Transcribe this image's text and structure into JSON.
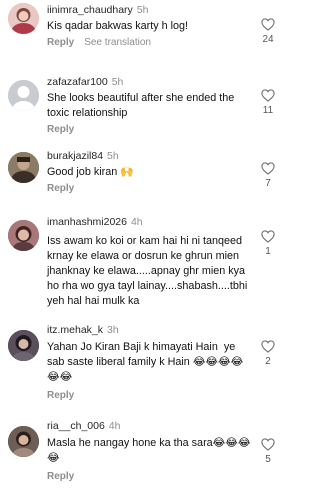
{
  "comments": [
    {
      "username": "iinimra_chaudhary",
      "time": "5h",
      "text": "Kis qadar bakwas karty h log!",
      "reply_label": "Reply",
      "translate_label": "See translation",
      "likes": "24"
    },
    {
      "username": "zafazafar100",
      "time": "5h",
      "text": "She looks beautiful after she ended the toxic relationship",
      "reply_label": "Reply",
      "likes": "11"
    },
    {
      "username": "burakjazil84",
      "time": "5h",
      "text": "Good job kiran 🙌",
      "reply_label": "Reply",
      "likes": "7"
    },
    {
      "username": "imanhashmi2026",
      "time": "4h",
      "text": "Iss awam ko koi or kam hai hi ni tanqeed krnay ke elawa or dosrun ke ghrun mien jhanknay ke elawa.....apnay ghr mien kya ho rha wo gya tayl lainay....shabash....tbhi yeh hal hai mulk ka",
      "reply_label": "Reply",
      "likes": "1"
    },
    {
      "username": "itz.mehak_k",
      "time": "3h",
      "text": "Yahan Jo Kiran Baji k himayati Hain  ye sab saste liberal family k Hain 😂😂😂😂😂😂",
      "reply_label": "Reply",
      "likes": "2"
    },
    {
      "username": "ria__ch_006",
      "time": "4h",
      "text": "Masla he nangay hone ka tha sara😂😂😂😂",
      "reply_label": "Reply",
      "likes": "5"
    }
  ],
  "colors": {
    "avatar1": "#c9a3a8",
    "avatar2": "#c8ccd1",
    "avatar3": "#6b5a4a",
    "avatar4": "#8a5a5e",
    "avatar5": "#3b3340",
    "avatar6": "#4a3a35"
  },
  "icons": {
    "like": "heart-outline-icon",
    "default_avatar": "person-icon"
  }
}
